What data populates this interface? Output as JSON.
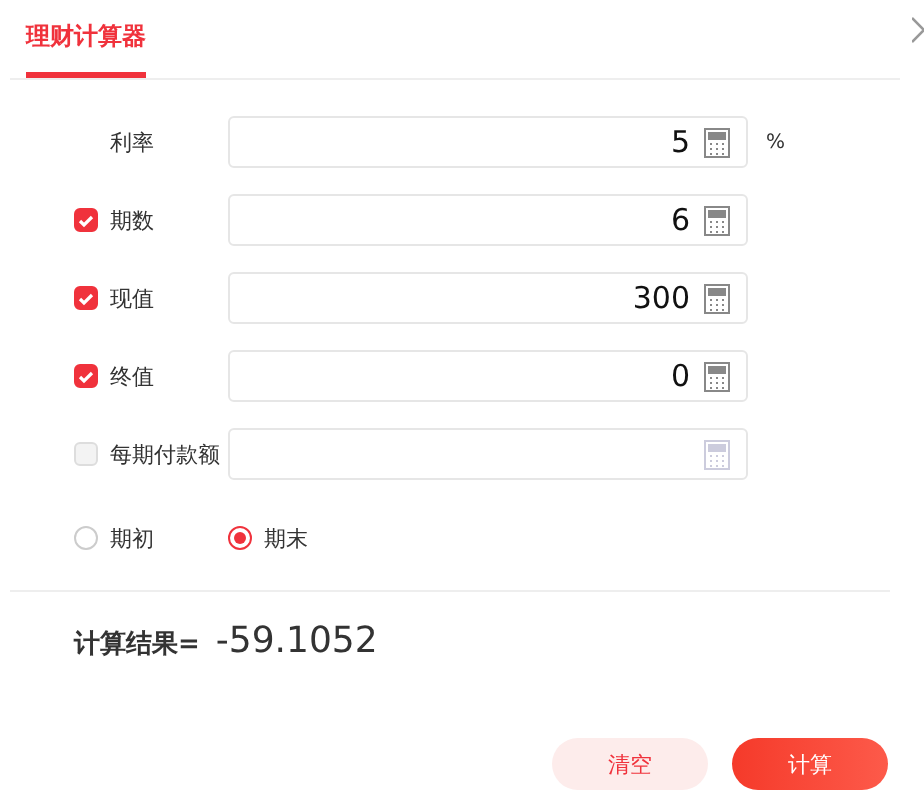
{
  "tabs": [
    {
      "label": "理财计算器",
      "selected": true
    }
  ],
  "fields": [
    {
      "kind": "plain",
      "label": "利率",
      "value": "5",
      "unit": "%"
    },
    {
      "kind": "checkbox",
      "label": "期数",
      "checked": true,
      "value": "6"
    },
    {
      "kind": "checkbox",
      "label": "现值",
      "checked": true,
      "value": "300"
    },
    {
      "kind": "checkbox",
      "label": "终值",
      "checked": true,
      "value": "0"
    },
    {
      "kind": "checkbox",
      "label": "每期付款额",
      "checked": false
    }
  ],
  "timing": [
    {
      "label": "期初",
      "selected": false
    },
    {
      "label": "期末",
      "selected": true
    }
  ],
  "result": {
    "label": "计算结果=",
    "value": "-59.1052"
  },
  "buttons": [
    {
      "kind": "secondary",
      "label": "清空"
    },
    {
      "kind": "primary",
      "label": "计算"
    }
  ]
}
